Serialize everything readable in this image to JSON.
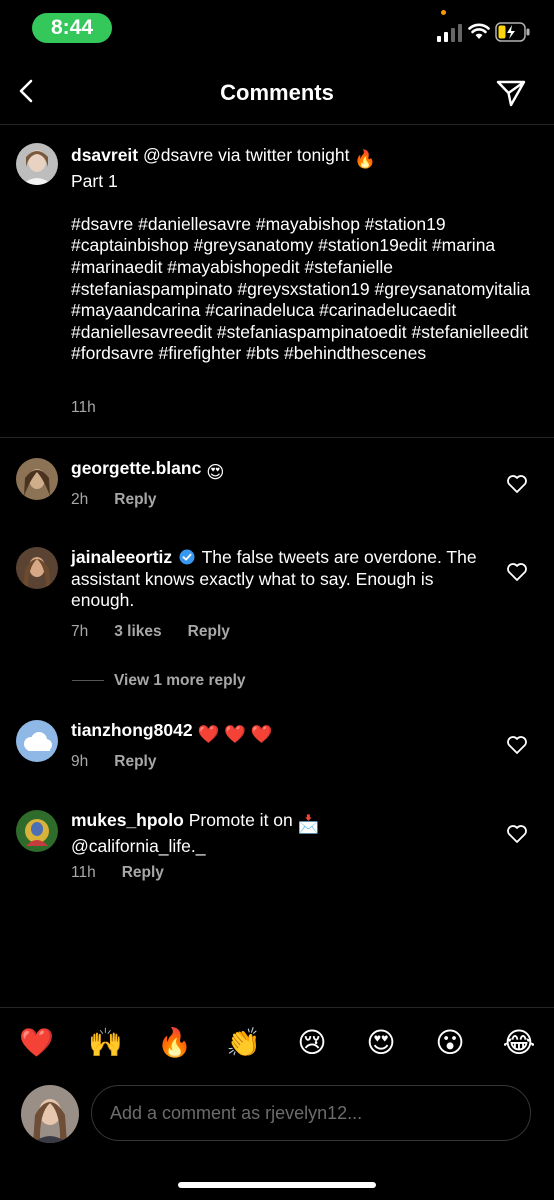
{
  "status": {
    "time": "8:44"
  },
  "header": {
    "title": "Comments"
  },
  "caption": {
    "username": "dsavreit",
    "text_line1": " @dsavre via twitter tonight ",
    "text_line2": "Part 1",
    "hashtags": "#dsavre #daniellesavre #mayabishop #station19 #captainbishop #greysanatomy #station19edit #marina #marinaedit #mayabishopedit #stefanielle #stefaniaspampinato #greysxstation19 #greysanatomyitalia #mayaandcarina #carinadeluca #carinadelucaedit #daniellesavreedit #stefaniaspampinatoedit #stefanielleedit #fordsavre #firefighter #bts #behindthescenes",
    "time": "11h"
  },
  "comments": [
    {
      "username": "georgette.blanc",
      "text": "",
      "emoji": "😍",
      "time": "2h",
      "likes": "",
      "reply": "Reply"
    },
    {
      "username": "jainaleeortiz",
      "text": "The false tweets are overdone. The assistant knows exactly what to say. Enough is enough.",
      "time": "7h",
      "likes": "3 likes",
      "reply": "Reply"
    },
    {
      "username": "tianzhong8042",
      "text": "",
      "emoji": "❤️ ❤️ ❤️",
      "time": "9h",
      "likes": "",
      "reply": "Reply"
    },
    {
      "username": "mukes_hpolo",
      "text": "Promote it on",
      "emoji": "📩",
      "text2": "@california_life._",
      "time": "11h",
      "likes": "",
      "reply": "Reply"
    }
  ],
  "view_more": "View 1 more reply",
  "emoji_bar": [
    "❤️",
    "🙌",
    "🔥",
    "👏",
    "😢",
    "😍",
    "😮",
    "😂"
  ],
  "input": {
    "placeholder": "Add a comment as rjevelyn12..."
  },
  "icons": {
    "back": "chevron-left-icon",
    "send": "paper-plane-icon",
    "like": "heart-outline-icon",
    "verified": "verified-badge-icon"
  },
  "colors": {
    "status_pill": "#34c759",
    "verified": "#3897f0",
    "muted_text": "#a8a8a8"
  }
}
